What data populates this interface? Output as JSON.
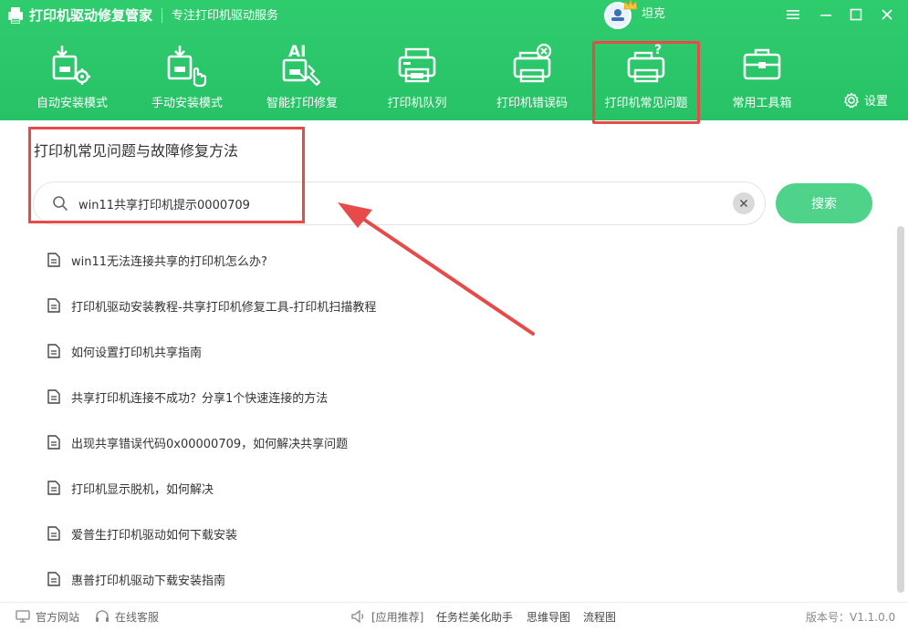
{
  "app": {
    "title": "打印机驱动修复管家",
    "subtitle": "专注打印机驱动服务",
    "username": "坦克"
  },
  "nav": {
    "items": [
      {
        "label": "自动安装模式",
        "icon": "auto-install-icon"
      },
      {
        "label": "手动安装模式",
        "icon": "manual-install-icon"
      },
      {
        "label": "智能打印修复",
        "icon": "ai-repair-icon"
      },
      {
        "label": "打印机队列",
        "icon": "printer-queue-icon"
      },
      {
        "label": "打印机错误码",
        "icon": "printer-error-icon"
      },
      {
        "label": "打印机常见问题",
        "icon": "printer-question-icon",
        "active": true
      },
      {
        "label": "常用工具箱",
        "icon": "toolbox-icon"
      }
    ],
    "settings_label": "设置"
  },
  "main": {
    "page_title": "打印机常见问题与故障修复方法",
    "search": {
      "value": "win11共享打印机提示0000709",
      "button_label": "搜索"
    },
    "faq": [
      "win11无法连接共享的打印机怎么办?",
      "打印机驱动安装教程-共享打印机修复工具-打印机扫描教程",
      "如何设置打印机共享指南",
      "共享打印机连接不成功？分享1个快速连接的方法",
      "出现共享错误代码0x00000709，如何解决共享问题",
      "打印机显示脱机，如何解决",
      "爱普生打印机驱动如何下载安装",
      "惠普打印机驱动下载安装指南"
    ]
  },
  "footer": {
    "website": "官方网站",
    "support": "在线客服",
    "recommend": "[应用推荐]",
    "links": [
      "任务栏美化助手",
      "思维导图",
      "流程图"
    ],
    "version": "版本号：V1.1.0.0"
  },
  "colors": {
    "header_green": "#2fcc6e",
    "button_green": "#4fd28a",
    "highlight_red": "#e84a4a"
  }
}
